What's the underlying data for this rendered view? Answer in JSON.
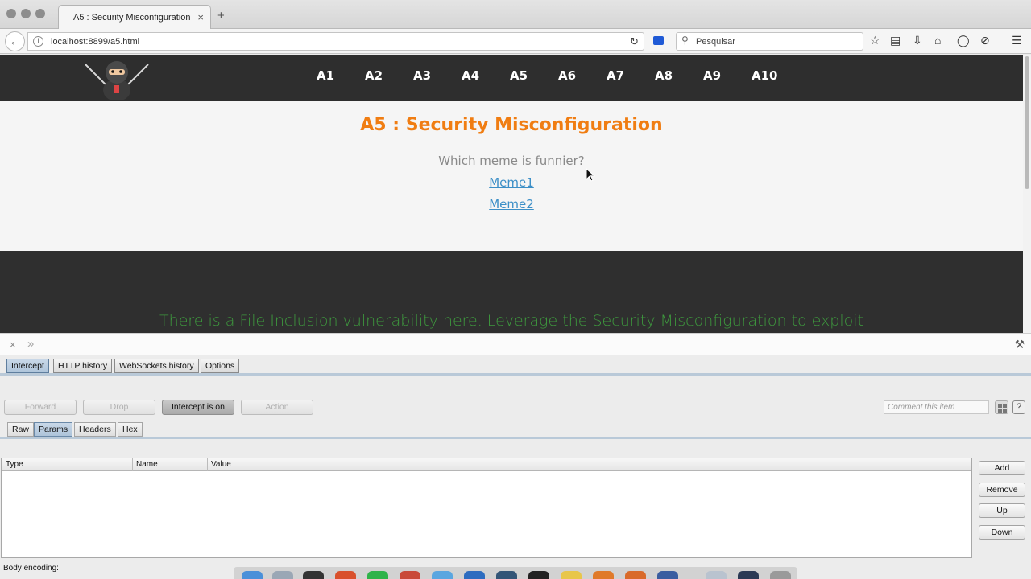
{
  "browser": {
    "tab_title": "A5 : Security Misconfiguration",
    "tab_close": "×",
    "new_tab": "+",
    "url": "localhost:8899/a5.html",
    "search_placeholder": "Pesquisar"
  },
  "site": {
    "nav_links": [
      "A1",
      "A2",
      "A3",
      "A4",
      "A5",
      "A6",
      "A7",
      "A8",
      "A9",
      "A10"
    ],
    "title": "A5 : Security Misconfiguration",
    "question": "Which meme is funnier?",
    "meme_links": [
      "Meme1",
      "Meme2"
    ],
    "hint": "There is a File Inclusion vulnerability here. Leverage the Security Misconfiguration to exploit"
  },
  "burp": {
    "top_tabs": [
      "Intercept",
      "HTTP history",
      "WebSockets history",
      "Options"
    ],
    "buttons": {
      "forward": "Forward",
      "drop": "Drop",
      "intercept": "Intercept is on",
      "action": "Action"
    },
    "comment_placeholder": "Comment this item",
    "help": "?",
    "sub_tabs": [
      "Raw",
      "Params",
      "Headers",
      "Hex"
    ],
    "table_headers": [
      "Type",
      "Name",
      "Value"
    ],
    "side_buttons": [
      "Add",
      "Remove",
      "Up",
      "Down"
    ],
    "body_encoding": "Body encoding:"
  },
  "colors": {
    "title_orange": "#f07d12",
    "hint_green": "#3e9a3e",
    "link_blue": "#3c8fc7",
    "nav_dark": "#2e2e2e"
  }
}
